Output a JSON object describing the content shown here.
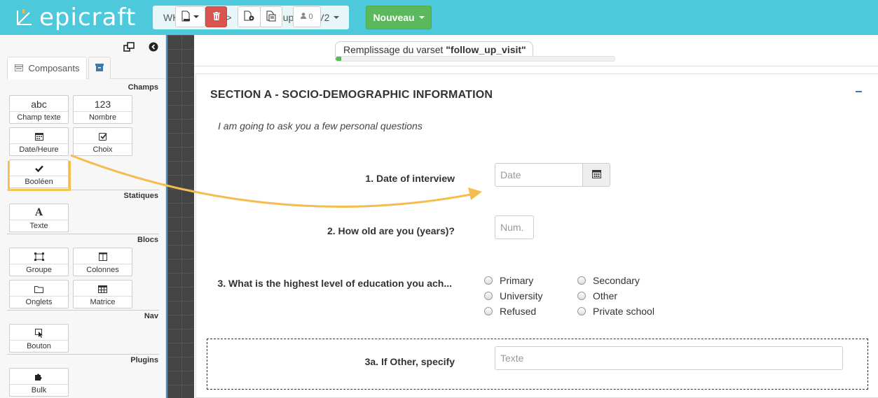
{
  "header": {
    "logo_text": "epicraft",
    "breadcrumb_project": "WHO Demo",
    "breadcrumb_separator": ">",
    "breadcrumb_form": "Follow-up Visit V2",
    "new_button_label": "Nouveau",
    "bar_color": "#4ec9dc"
  },
  "sidebar": {
    "tab_components": "Composants",
    "sections": {
      "fields": "Champs",
      "statics": "Statiques",
      "blocks": "Blocs",
      "nav": "Nav",
      "plugins": "Plugins"
    },
    "components": {
      "text_field": {
        "icon": "abc",
        "label": "Champ texte"
      },
      "number": {
        "icon": "123",
        "label": "Nombre"
      },
      "datetime": {
        "icon": "calendar-icon",
        "label": "Date/Heure"
      },
      "choice": {
        "icon": "checkbox-icon",
        "label": "Choix"
      },
      "boolean": {
        "icon": "check-icon",
        "label": "Booléen"
      },
      "text": {
        "icon": "A",
        "label": "Texte"
      },
      "group": {
        "icon": "group-icon",
        "label": "Groupe"
      },
      "columns": {
        "icon": "columns-icon",
        "label": "Colonnes"
      },
      "tabs": {
        "icon": "folder-icon",
        "label": "Onglets"
      },
      "matrix": {
        "icon": "table-icon",
        "label": "Matrice"
      },
      "button": {
        "icon": "cursor-icon",
        "label": "Bouton"
      },
      "bulk": {
        "icon": "puzzle-icon",
        "label": "Bulk"
      }
    }
  },
  "toolbar": {
    "user_count": "0",
    "progress_prefix": "Remplissage du varset ",
    "progress_varset": "\"follow_up_visit\"",
    "progress_fraction": 0.02,
    "delete_color": "#d9534f"
  },
  "form": {
    "section_title": "SECTION A - SOCIO-DEMOGRAPHIC INFORMATION",
    "intro": "I am going to ask you a few personal questions",
    "q1": {
      "label": "1. Date of interview",
      "placeholder": "Date"
    },
    "q2": {
      "label": "2. How old are you (years)?",
      "placeholder": "Num."
    },
    "q3": {
      "label": "3. What is the highest level of education you ach...",
      "options": [
        "Primary",
        "Secondary",
        "University",
        "Other",
        "Refused",
        "Private school"
      ]
    },
    "q3a": {
      "label": "3a. If Other, specify",
      "placeholder": "Texte"
    }
  },
  "highlight_color": "#f5bd4f"
}
